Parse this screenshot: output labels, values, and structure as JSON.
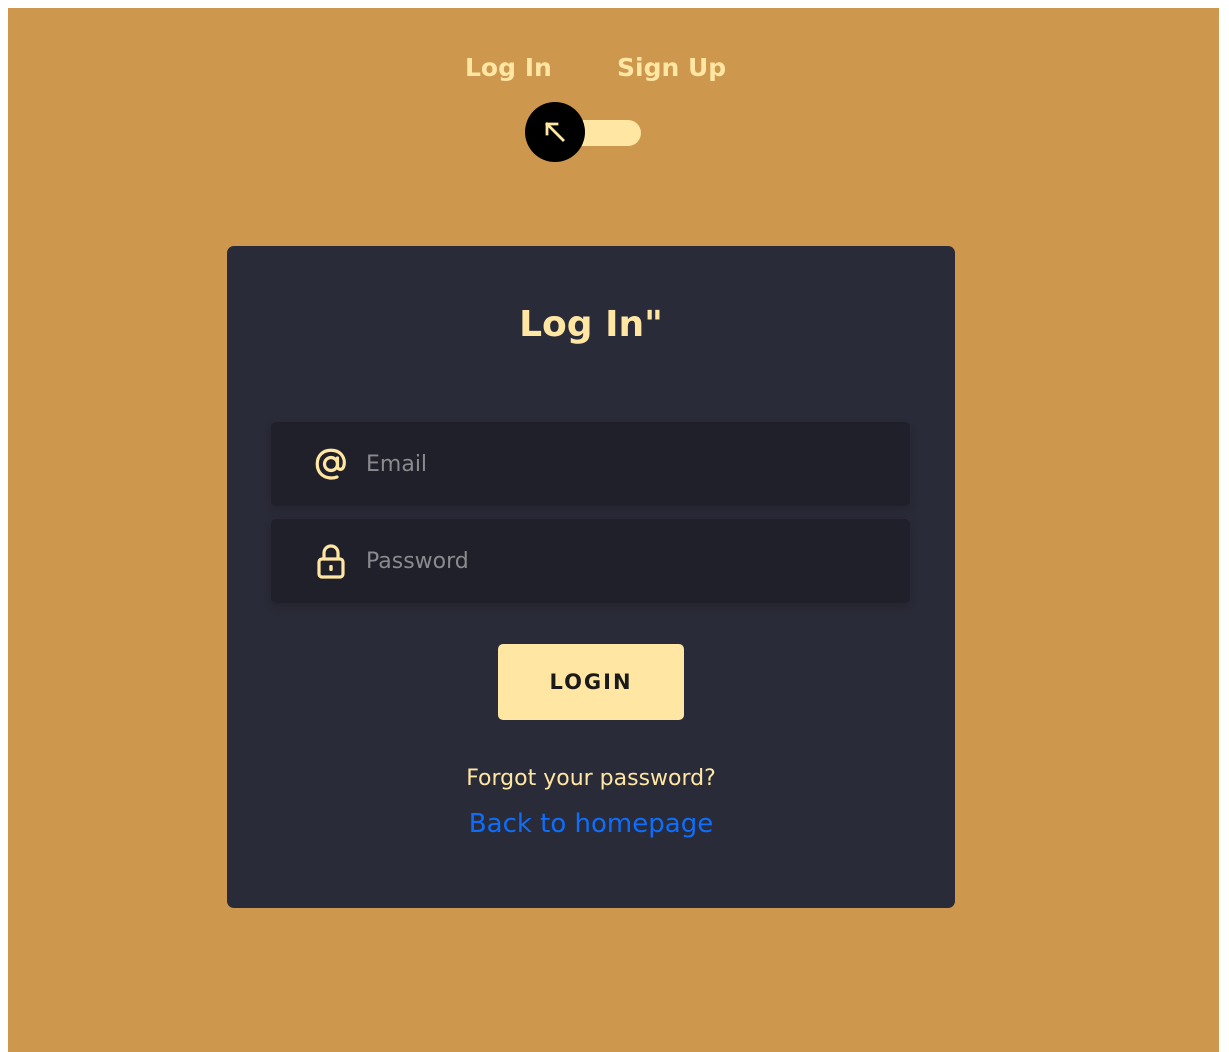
{
  "colors": {
    "page_background": "#CD974D",
    "card_background": "#2A2B38",
    "field_background": "#1F2029",
    "accent": "#FFE6A3",
    "link": "#0D6EFD",
    "toggle_knob": "#000000"
  },
  "mode_switch": {
    "login_label": "Log In",
    "signup_label": "Sign Up",
    "toggle_state": "login",
    "knob_icon": "arrow-up-left-icon"
  },
  "card": {
    "title": "Log In\"",
    "email_field": {
      "placeholder": "Email",
      "value": "",
      "icon": "at-sign-icon"
    },
    "password_field": {
      "placeholder": "Password",
      "value": "",
      "icon": "lock-icon"
    },
    "login_button_label": "LOGIN",
    "forgot_link": "Forgot your password?",
    "back_link": "Back to homepage"
  }
}
